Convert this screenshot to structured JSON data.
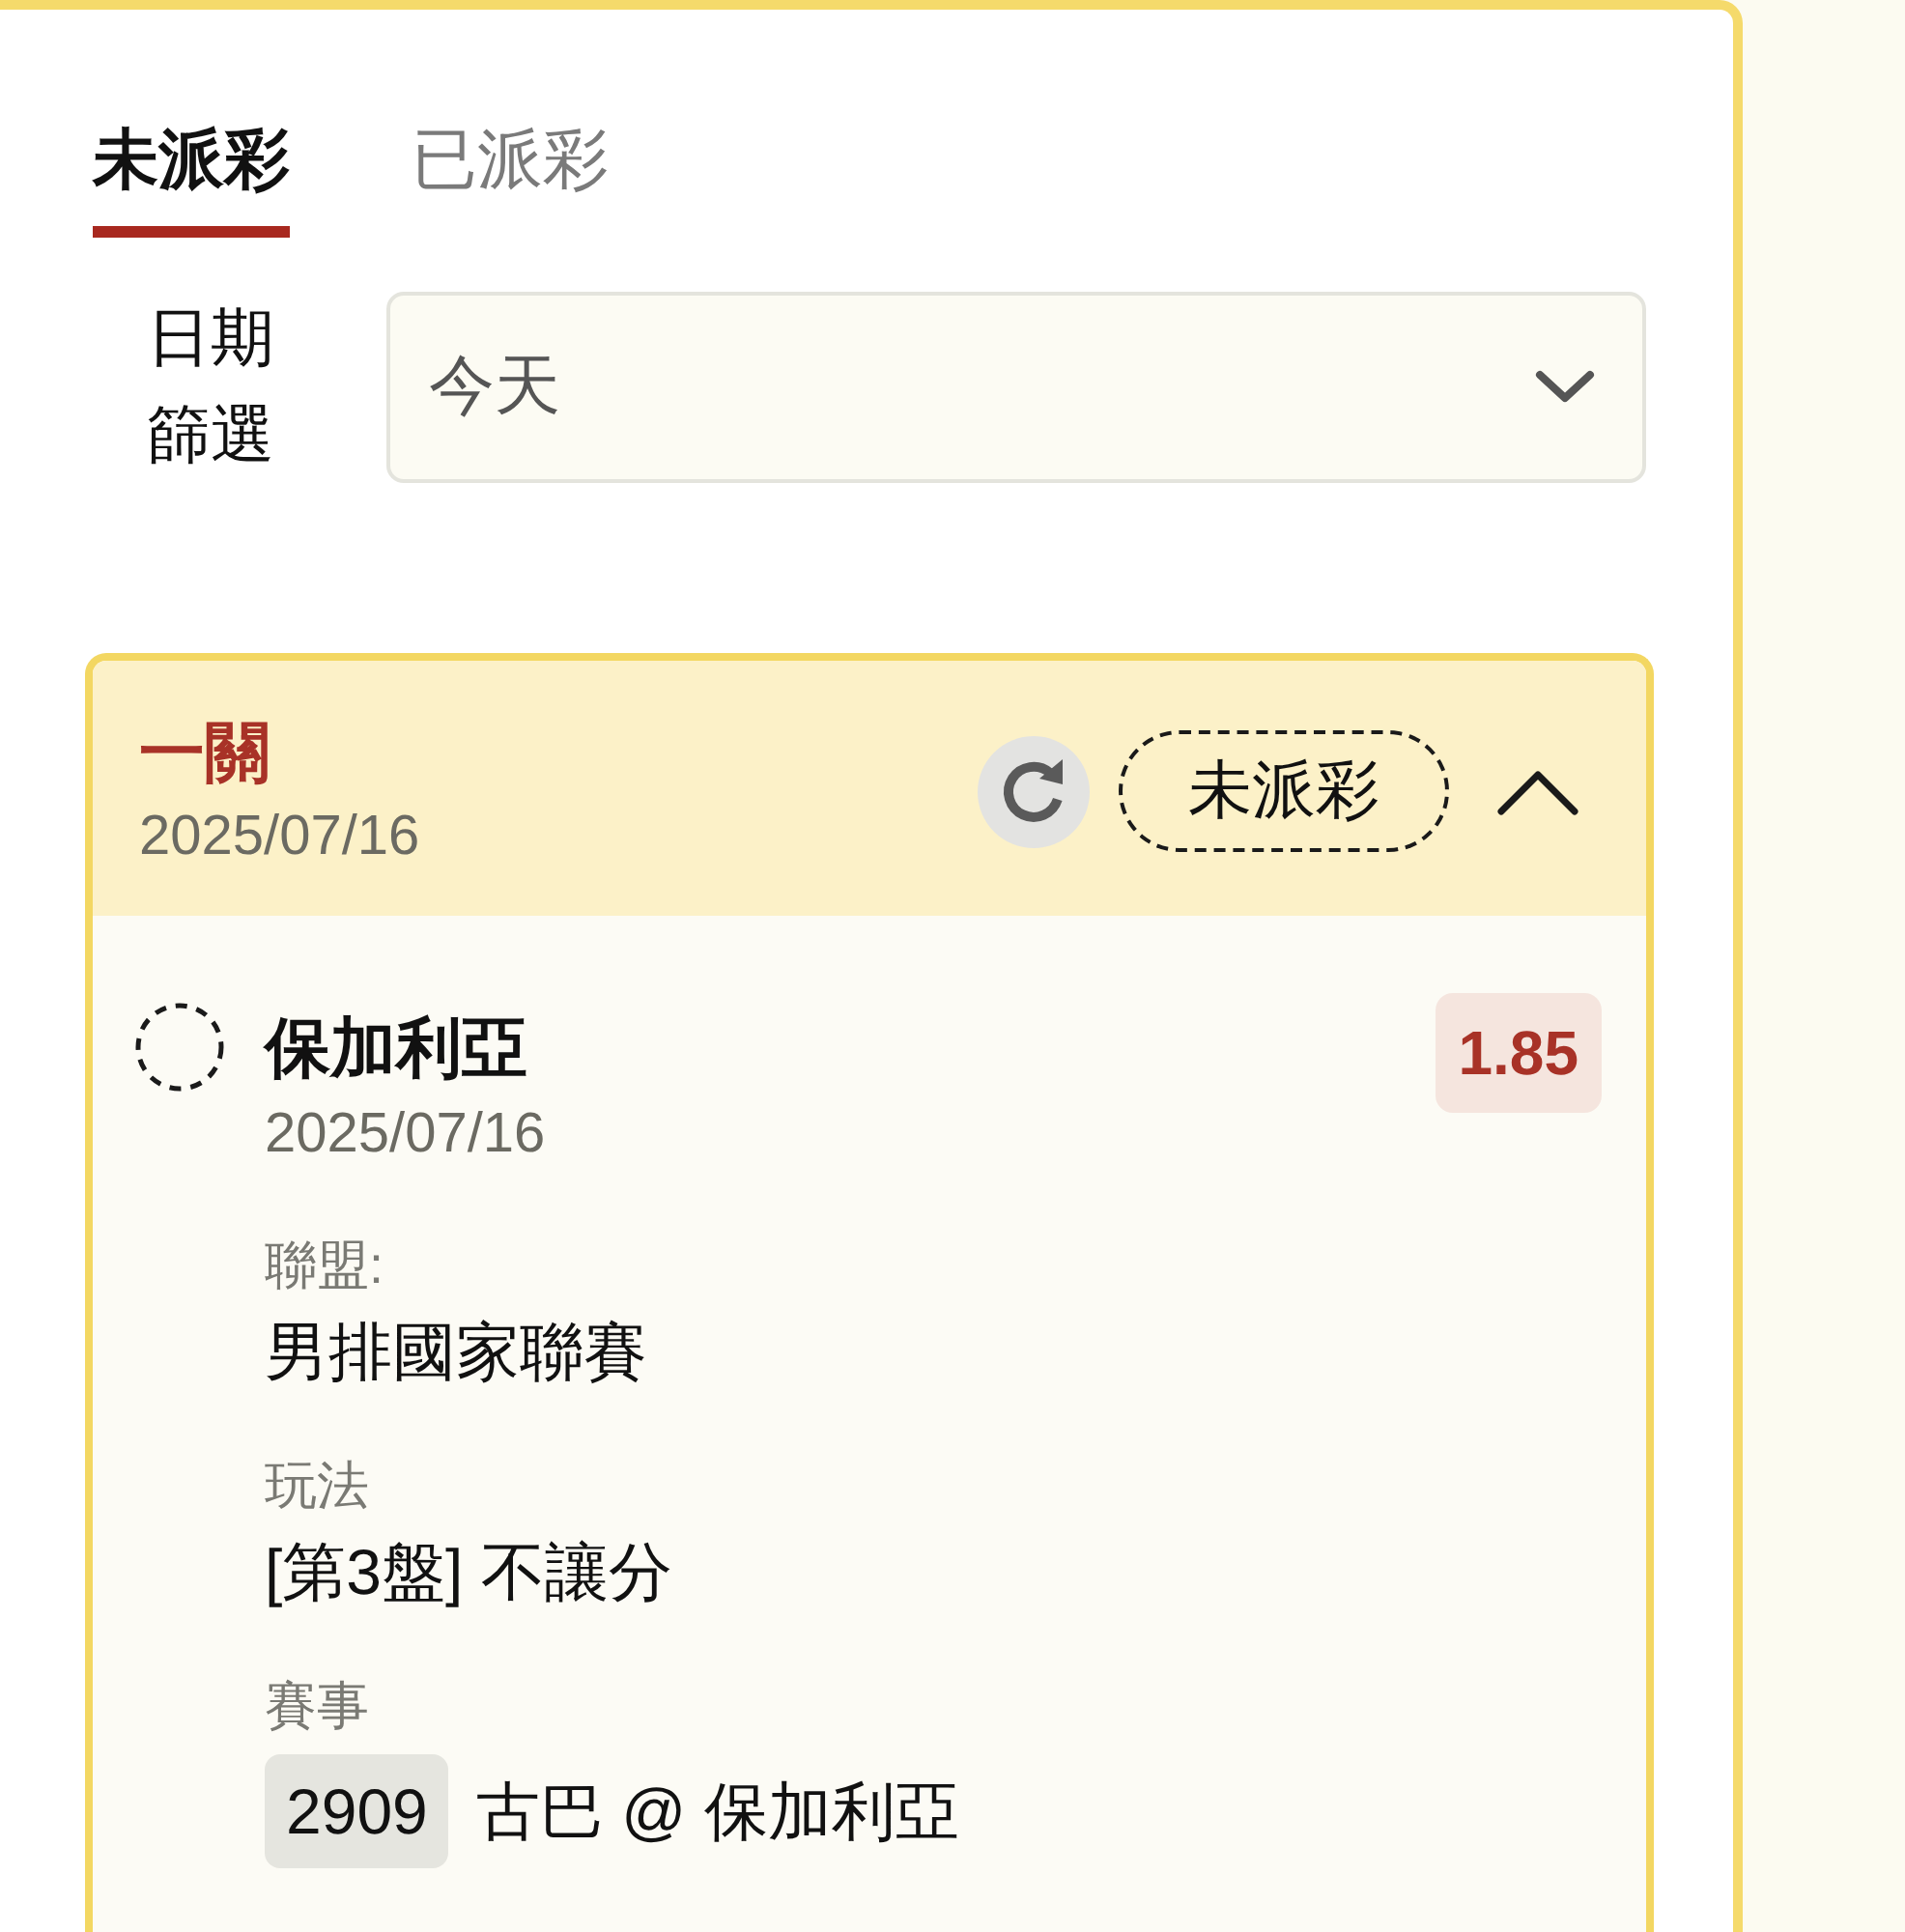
{
  "tabs": [
    {
      "label": "未派彩",
      "selected": true
    },
    {
      "label": "已派彩",
      "selected": false
    }
  ],
  "date_filter": {
    "label": "日期篩選",
    "value": "今天"
  },
  "bets": [
    {
      "title": "一關",
      "date": "2025/07/16",
      "status": "未派彩",
      "expanded": true,
      "selections": [
        {
          "pending": true,
          "name": "保加利亞",
          "date": "2025/07/16",
          "odds": "1.85",
          "fields": [
            {
              "kind": "text",
              "label": "聯盟:",
              "value": "男排國家聯賽"
            },
            {
              "kind": "text",
              "label": "玩法",
              "value": "[第3盤] 不讓分"
            },
            {
              "kind": "match",
              "label": "賽事",
              "match_id": "2909",
              "value": "古巴 @ 保加利亞"
            }
          ]
        }
      ]
    }
  ]
}
